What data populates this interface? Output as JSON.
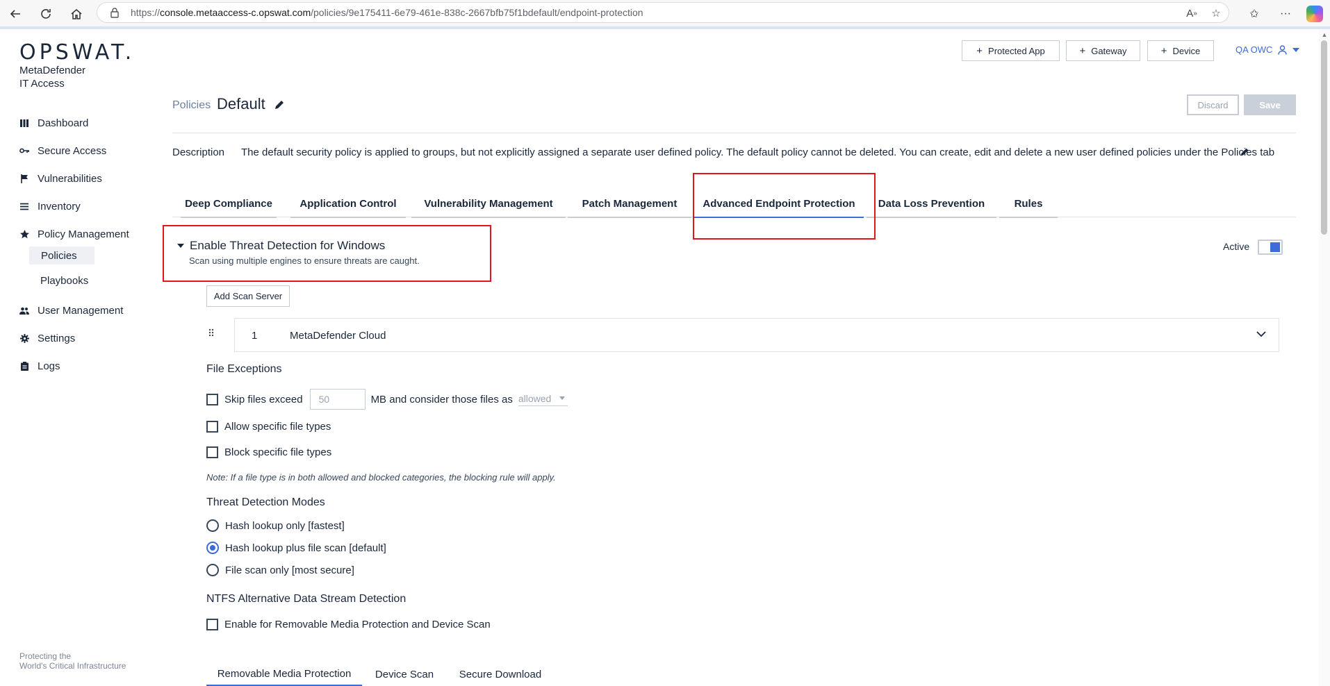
{
  "browser": {
    "url_prefix": "https://",
    "url_host": "console.metaaccess-c.opswat.com",
    "url_path": "/policies/9e175411-6e79-461e-838c-2667bfb75f1bdefault/endpoint-protection"
  },
  "brand": {
    "logo": "OPSWAT.",
    "product_line1": "MetaDefender",
    "product_line2": "IT Access",
    "tagline_line1": "Protecting the",
    "tagline_line2": "World's Critical Infrastructure"
  },
  "sidebar": {
    "items": [
      {
        "label": "Dashboard",
        "icon": "dashboard-icon"
      },
      {
        "label": "Secure Access",
        "icon": "key-icon"
      },
      {
        "label": "Vulnerabilities",
        "icon": "flag-icon"
      },
      {
        "label": "Inventory",
        "icon": "list-icon"
      },
      {
        "label": "Policy Management",
        "icon": "star-icon"
      },
      {
        "label": "User Management",
        "icon": "users-icon"
      },
      {
        "label": "Settings",
        "icon": "gear-icon"
      },
      {
        "label": "Logs",
        "icon": "clipboard-icon"
      }
    ],
    "sub_items": [
      {
        "label": "Policies",
        "active": true
      },
      {
        "label": "Playbooks",
        "active": false
      }
    ]
  },
  "topbar": {
    "protected_app": "Protected App",
    "gateway": "Gateway",
    "device": "Device",
    "user": "QA OWC"
  },
  "header": {
    "breadcrumb": "Policies",
    "title": "Default",
    "discard": "Discard",
    "save": "Save",
    "description_label": "Description",
    "description": "The default security policy is applied to groups, but not explicitly assigned a separate user defined policy. The default policy cannot be deleted. You can create, edit and delete a new user defined policies under the Policies tab"
  },
  "tabs": [
    {
      "label": "Deep Compliance",
      "active": false
    },
    {
      "label": "Application Control",
      "active": false
    },
    {
      "label": "Vulnerability Management",
      "active": false
    },
    {
      "label": "Patch Management",
      "active": false
    },
    {
      "label": "Advanced Endpoint Protection",
      "active": true
    },
    {
      "label": "Data Loss Prevention",
      "active": false
    },
    {
      "label": "Rules",
      "active": false
    }
  ],
  "threat": {
    "title": "Enable Threat Detection for Windows",
    "subtitle": "Scan using multiple engines to ensure threats are caught.",
    "active_label": "Active",
    "active": true,
    "add_server": "Add Scan Server",
    "servers": [
      {
        "index": "1",
        "name": "MetaDefender Cloud"
      }
    ]
  },
  "file_exceptions": {
    "heading": "File Exceptions",
    "skip_label": "Skip files exceed",
    "skip_value": "50",
    "skip_suffix": "MB and consider those files as",
    "skip_select": "allowed",
    "allow_types": "Allow specific file types",
    "block_types": "Block specific file types",
    "note": "Note: If a file type is in both allowed and blocked categories, the blocking rule will apply."
  },
  "modes": {
    "heading": "Threat Detection Modes",
    "options": [
      {
        "label": "Hash lookup only [fastest]",
        "selected": false
      },
      {
        "label": "Hash lookup plus file scan [default]",
        "selected": true
      },
      {
        "label": "File scan only [most secure]",
        "selected": false
      }
    ]
  },
  "ntfs": {
    "heading": "NTFS Alternative Data Stream Detection",
    "checkbox": "Enable for Removable Media Protection and Device Scan"
  },
  "subtabs": [
    {
      "label": "Removable Media Protection",
      "active": true
    },
    {
      "label": "Device Scan",
      "active": false
    },
    {
      "label": "Secure Download",
      "active": false
    }
  ],
  "colors": {
    "accent": "#3d6bd8",
    "highlight_box": "#e0161b",
    "text": "#1b273a"
  }
}
